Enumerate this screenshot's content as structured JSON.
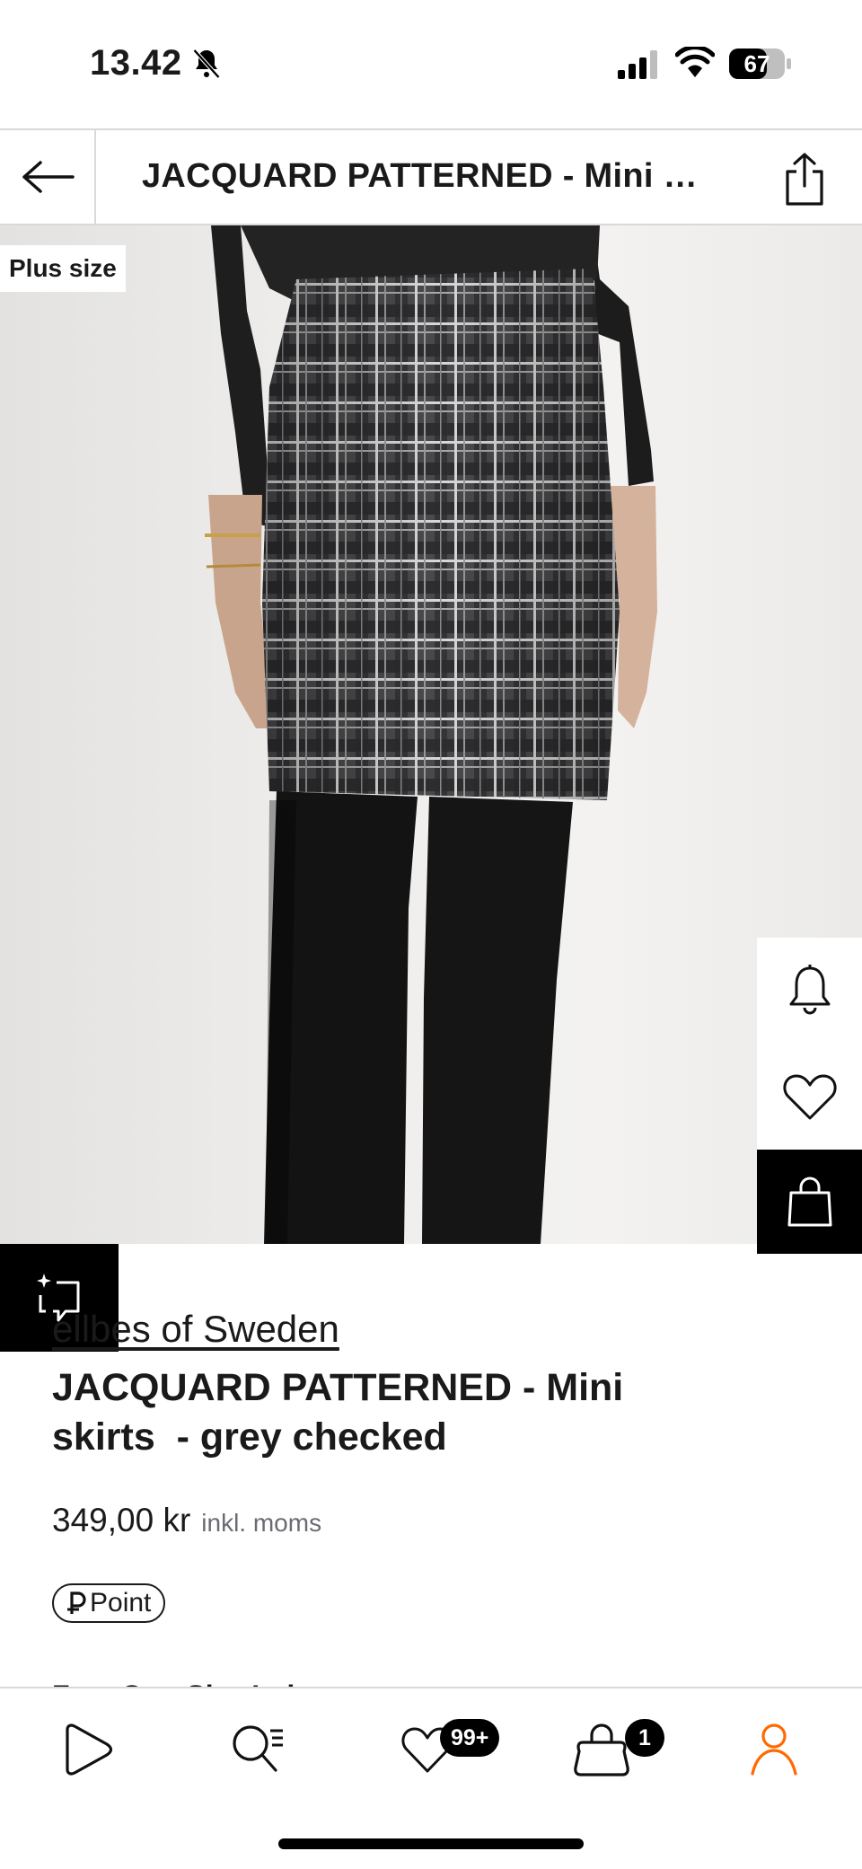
{
  "status_bar": {
    "time": "13.42",
    "battery": "67"
  },
  "header": {
    "title": "JACQUARD PATTERNED - Mini skirts - grey checked"
  },
  "hero": {
    "badge": "Plus size"
  },
  "product": {
    "brand": "Ellbes of Sweden",
    "brand_visible": "ellbes of Sweden",
    "title_line1": "JACQUARD PATTERNED - Mini",
    "title_line2": "skirts  - grey checked",
    "price": "349,00 kr",
    "vat_note": "inkl. moms",
    "point_label": "Point",
    "next_section_partial": "Free One-Size Ind"
  },
  "nav": {
    "wishlist_badge": "99+",
    "bag_badge": "1",
    "accent_color": "#ff6900"
  },
  "icons": [
    "bell-off-icon",
    "signal-icon",
    "wifi-icon",
    "battery-icon",
    "back-arrow-icon",
    "share-icon",
    "bell-icon",
    "heart-icon",
    "bag-icon",
    "ai-compare-icon",
    "home-icon",
    "search-icon",
    "heart-icon",
    "bag-icon",
    "user-icon"
  ]
}
